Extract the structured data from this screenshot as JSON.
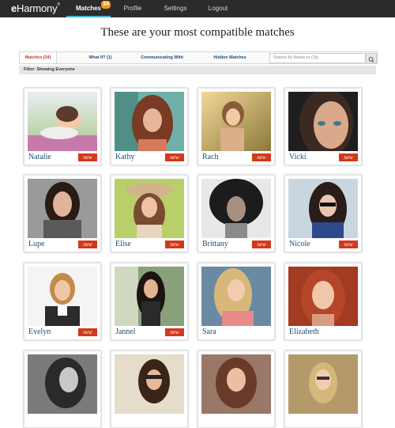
{
  "brand": {
    "logo_e": "e",
    "logo_rest": "Harmony",
    "logo_mark": "®"
  },
  "nav": {
    "items": [
      {
        "label": "Matches",
        "badge": "34",
        "active": true
      },
      {
        "label": "Profile"
      },
      {
        "label": "Settings"
      },
      {
        "label": "Logout"
      }
    ]
  },
  "headline": "These are your most compatible matches",
  "tabs": [
    {
      "label": "Matches (34)"
    },
    {
      "label": "What If? (1)"
    },
    {
      "label": "Communicating With"
    },
    {
      "label": "Hidden Matches"
    }
  ],
  "search": {
    "placeholder": "Search by Name or City",
    "icon": "search-icon"
  },
  "filter": "Filter: Showing Everyone",
  "matches": [
    {
      "name": "Natalie",
      "new": "new"
    },
    {
      "name": "Kathy",
      "new": "new"
    },
    {
      "name": "Rach",
      "new": "new"
    },
    {
      "name": "Vicki",
      "new": "new"
    },
    {
      "name": "Lupe",
      "new": "new"
    },
    {
      "name": "Elise",
      "new": "new"
    },
    {
      "name": "Brittany",
      "new": "new"
    },
    {
      "name": "Nicole",
      "new": "new"
    },
    {
      "name": "Evelyn",
      "new": "new"
    },
    {
      "name": "Jannel",
      "new": "new"
    },
    {
      "name": "Sara"
    },
    {
      "name": "Elizabeth"
    },
    {
      "name": ""
    },
    {
      "name": ""
    },
    {
      "name": ""
    },
    {
      "name": ""
    }
  ],
  "colors": {
    "accent": "#47b4d9",
    "badge": "#f39a1c",
    "new_tag": "#d03a1a",
    "name": "#1d4d73",
    "topbar": "#2b2b2b"
  }
}
